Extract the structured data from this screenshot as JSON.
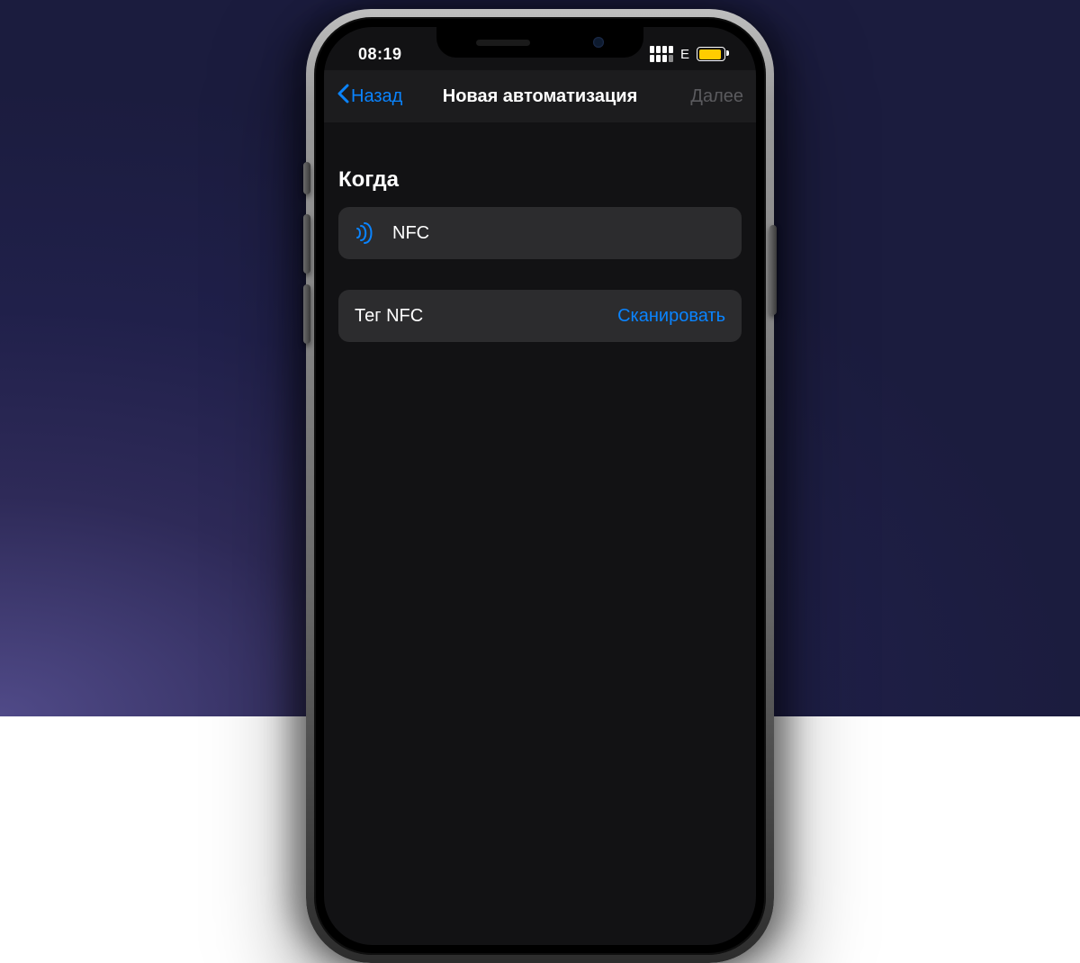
{
  "status": {
    "time": "08:19",
    "network_type": "E"
  },
  "nav": {
    "back_label": "Назад",
    "title": "Новая автоматизация",
    "next_label": "Далее"
  },
  "content": {
    "section_title": "Когда",
    "trigger_row": {
      "label": "NFC"
    },
    "tag_row": {
      "label": "Тег NFC",
      "action_label": "Сканировать"
    }
  }
}
